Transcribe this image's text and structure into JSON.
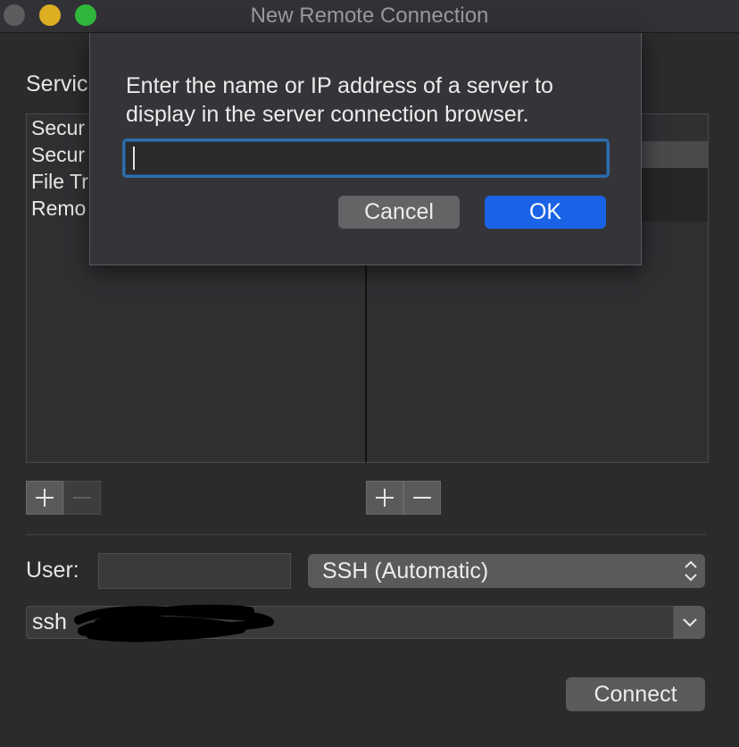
{
  "window": {
    "title": "New Remote Connection"
  },
  "service": {
    "label": "Servic",
    "items": [
      "Secur",
      "Secur",
      "File Tr",
      "Remo"
    ]
  },
  "footer": {
    "user_label": "User:",
    "user_value": "",
    "protocol": "SSH (Automatic)",
    "command": "ssh",
    "connect_label": "Connect"
  },
  "sheet": {
    "message": "Enter the name or IP address of a server to display in the server connection browser.",
    "input_value": "",
    "cancel_label": "Cancel",
    "ok_label": "OK"
  },
  "colors": {
    "accent": "#1a63e6",
    "focus_ring": "#2f6daa",
    "traffic_min": "#ddae22",
    "traffic_max": "#2fb83c"
  },
  "icons": {
    "add": "plus-icon",
    "remove": "minus-icon",
    "popup_arrows": "updown-chevron-icon",
    "combo_arrow": "chevron-down-icon"
  }
}
